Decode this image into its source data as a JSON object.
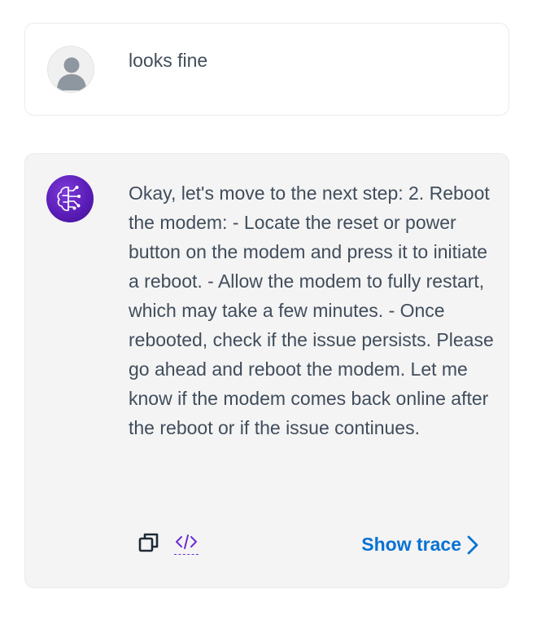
{
  "user_message": {
    "avatar_icon": "user-avatar-icon",
    "text": "looks fine"
  },
  "assistant_message": {
    "avatar_icon": "ai-brain-icon",
    "text": "Okay, let's move to the next step: 2. Reboot the modem: - Locate the reset or power button on the modem and press it to initiate a reboot. - Allow the modem to fully restart, which may take a few minutes. - Once rebooted, check if the issue persists. Please go ahead and reboot the modem. Let me know if the modem comes back online after the reboot or if the issue continues.",
    "actions": {
      "copy_icon": "copy-icon",
      "code_icon": "code-icon",
      "show_trace_label": "Show trace",
      "show_trace_icon": "chevron-right-icon"
    }
  },
  "colors": {
    "link": "#0972d3",
    "bot_avatar": "#5b1db8",
    "code_icon": "#6b2fd0",
    "text": "#414d5c",
    "bot_card_bg": "#f4f4f4"
  }
}
